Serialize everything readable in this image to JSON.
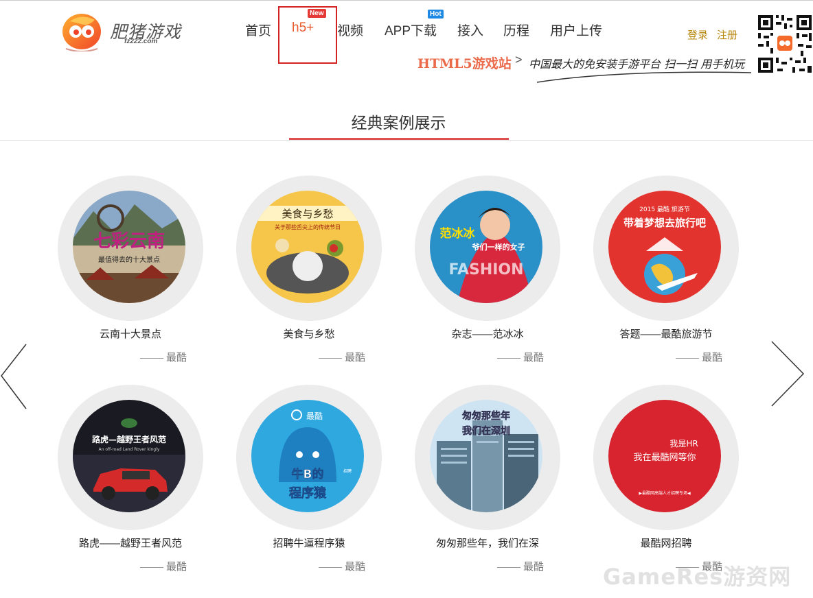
{
  "header": {
    "logo_name": "肥猪游戏",
    "logo_domain": "fz222.com",
    "nav": [
      {
        "label": "首页",
        "active": false
      },
      {
        "label": "h5+",
        "active": true,
        "badge": "New"
      },
      {
        "label": "视频",
        "active": false
      },
      {
        "label": "APP下载",
        "active": false,
        "badge": "Hot"
      },
      {
        "label": "接入",
        "active": false
      },
      {
        "label": "历程",
        "active": false
      },
      {
        "label": "用户上传",
        "active": false
      }
    ],
    "login": "登录",
    "register": "注册",
    "slogan_site": "HTML5游戏站",
    "slogan_arrow": ">",
    "slogan_text": "中国最大的免安装手游平台 扫一扫 用手机玩"
  },
  "section": {
    "title": "经典案例展示"
  },
  "cards": [
    {
      "title": "云南十大景点",
      "author": "最酷",
      "image_text": "七彩云南",
      "image_sub": "最值得去的十大景点"
    },
    {
      "title": "美食与乡愁",
      "author": "最酷",
      "image_text": "美食与乡愁",
      "image_sub": "关于那些舌尖上的传统节日"
    },
    {
      "title": "杂志——范冰冰",
      "author": "最酷",
      "image_text": "范冰冰",
      "image_sub": "爷们一样的女子",
      "image_extra": "FASHION"
    },
    {
      "title": "答题——最酷旅游节",
      "author": "最酷",
      "image_text": "带着梦想去旅行吧",
      "image_sub": "2015 最酷 旅游节"
    },
    {
      "title": "路虎——越野王者风范",
      "author": "最酷",
      "image_text": "路虎—越野王者风范",
      "image_sub": "An off-road Land Rover kingly"
    },
    {
      "title": "招聘牛逼程序猿",
      "author": "最酷",
      "image_text": "牛B的",
      "image_sub": "程序猿",
      "image_extra": "最酷",
      "image_tag": "招聘"
    },
    {
      "title": "匆匆那些年，我们在深",
      "author": "最酷",
      "image_text": "匆匆那些年",
      "image_sub": "我们在深圳"
    },
    {
      "title": "最酷网招聘",
      "author": "最酷",
      "image_text": "我是HR",
      "image_sub": "我在最酷网等你",
      "image_extra": "▶最酷网高端人才招聘专场◀"
    }
  ],
  "watermark": "GameRes游资网",
  "colors": {
    "accent": "#e85a2e",
    "section_underline": "#e05050",
    "auth_link": "#b8860b",
    "active_box": "#d32020"
  },
  "icons": {
    "prev": "chevron-left-icon",
    "next": "chevron-right-icon",
    "qr": "qr-code-icon"
  }
}
